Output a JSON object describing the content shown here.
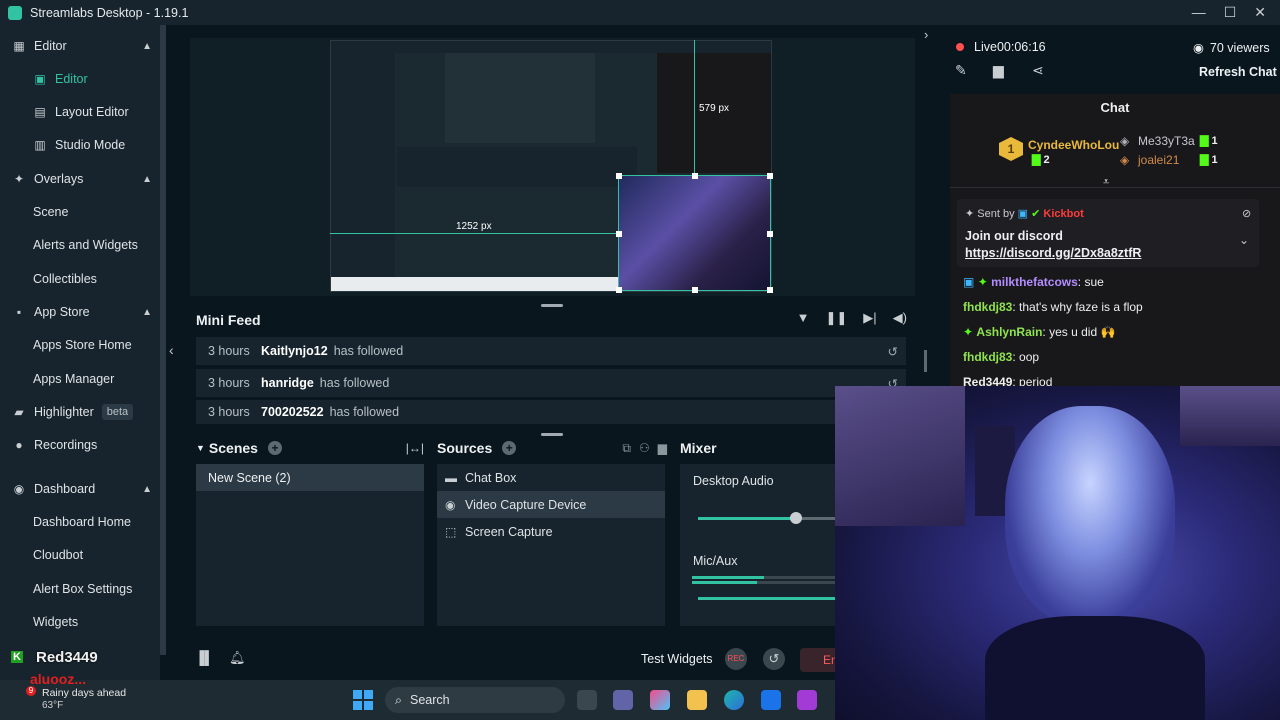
{
  "window": {
    "title": "Streamlabs Desktop - 1.19.1",
    "controls": [
      "—",
      "☐",
      "✕"
    ]
  },
  "sidebar": {
    "items": [
      {
        "label": "Editor",
        "kind": "group",
        "icon": "editor-icon",
        "expanded": true
      },
      {
        "label": "Editor",
        "kind": "sub",
        "icon": "editor-sub-icon",
        "active": true
      },
      {
        "label": "Layout Editor",
        "kind": "sub",
        "icon": "layout-icon"
      },
      {
        "label": "Studio Mode",
        "kind": "sub",
        "icon": "studio-mode-icon"
      },
      {
        "label": "Overlays",
        "kind": "group",
        "icon": "overlays-icon",
        "expanded": true
      },
      {
        "label": "Scene",
        "kind": "sub"
      },
      {
        "label": "Alerts and Widgets",
        "kind": "sub"
      },
      {
        "label": "Collectibles",
        "kind": "sub"
      },
      {
        "label": "App Store",
        "kind": "group",
        "icon": "store-icon",
        "expanded": true
      },
      {
        "label": "Apps Store Home",
        "kind": "sub"
      },
      {
        "label": "Apps Manager",
        "kind": "sub"
      },
      {
        "label": "Highlighter",
        "kind": "group",
        "icon": "highlighter-icon",
        "badge": "beta"
      },
      {
        "label": "Recordings",
        "kind": "group",
        "icon": "recordings-icon"
      },
      {
        "label": "Dashboard",
        "kind": "group",
        "icon": "dashboard-icon",
        "expanded": true
      },
      {
        "label": "Dashboard Home",
        "kind": "sub"
      },
      {
        "label": "Cloudbot",
        "kind": "sub"
      },
      {
        "label": "Alert Box Settings",
        "kind": "sub"
      },
      {
        "label": "Widgets",
        "kind": "sub"
      }
    ]
  },
  "preview": {
    "size_width": "1252 px",
    "size_height": "579 px"
  },
  "minifeed": {
    "title": "Mini Feed",
    "rows": [
      {
        "time": "3 hours",
        "name": "Kaitlynjo12",
        "event": "has followed"
      },
      {
        "time": "3 hours",
        "name": "hanridge",
        "event": "has followed"
      },
      {
        "time": "3 hours",
        "name": "700202522",
        "event": "has followed"
      }
    ]
  },
  "scenes": {
    "title": "Scenes",
    "items": [
      "New Scene (2)"
    ]
  },
  "sources": {
    "title": "Sources",
    "items": [
      {
        "label": "Chat Box",
        "icon": "chat-icon"
      },
      {
        "label": "Video Capture Device",
        "icon": "camera-icon",
        "selected": true
      },
      {
        "label": "Screen Capture",
        "icon": "screen-icon"
      }
    ]
  },
  "mixer": {
    "title": "Mixer",
    "channels": [
      {
        "label": "Desktop Audio",
        "level": 0.71
      },
      {
        "label": "Mic/Aux",
        "level": 0.5
      }
    ]
  },
  "footer": {
    "test_widgets": "Test Widgets",
    "rec": "REC",
    "end": "En"
  },
  "live": {
    "status": "Live",
    "timer": "00:06:16",
    "viewers": "70 viewers",
    "refresh": "Refresh Chat"
  },
  "chat": {
    "title": "Chat",
    "leaderboard": {
      "top": {
        "name": "CyndeeWhoLou",
        "rank": "1",
        "count": "2"
      },
      "second": {
        "name": "Me33yT3a",
        "count": "1"
      },
      "third": {
        "name": "joalei21",
        "count": "1"
      }
    },
    "pinned": {
      "sent_by_label": "Sent by",
      "sender": "Kickbot",
      "text": "Join our discord",
      "link": "https://discord.gg/2Dx8a8ztfR"
    },
    "messages": [
      {
        "user": "milkthefatcows",
        "text": "sue",
        "color": "#b48cff"
      },
      {
        "user": "fhdkdj83",
        "text": "that's why faze is a flop",
        "color": "#8fe34f"
      },
      {
        "user": "AshlynRain",
        "text": "yes u did 🙌",
        "color": "#8fe34f"
      },
      {
        "user": "fhdkdj83",
        "text": "oop",
        "color": "#8fe34f"
      },
      {
        "user": "Red3449",
        "text": "period",
        "color": "#efeff1"
      }
    ]
  },
  "overlay": {
    "chat_name": "Red3449",
    "name2": "aluooz...",
    "weather": "Rainy days ahead",
    "temp": "63°F",
    "notif_count": "9"
  },
  "taskbar": {
    "search_placeholder": "Search"
  },
  "colors": {
    "accent": "#31c3a2",
    "live_red": "#ff4f4f",
    "bg": "#09161d",
    "panel": "#17242d"
  }
}
